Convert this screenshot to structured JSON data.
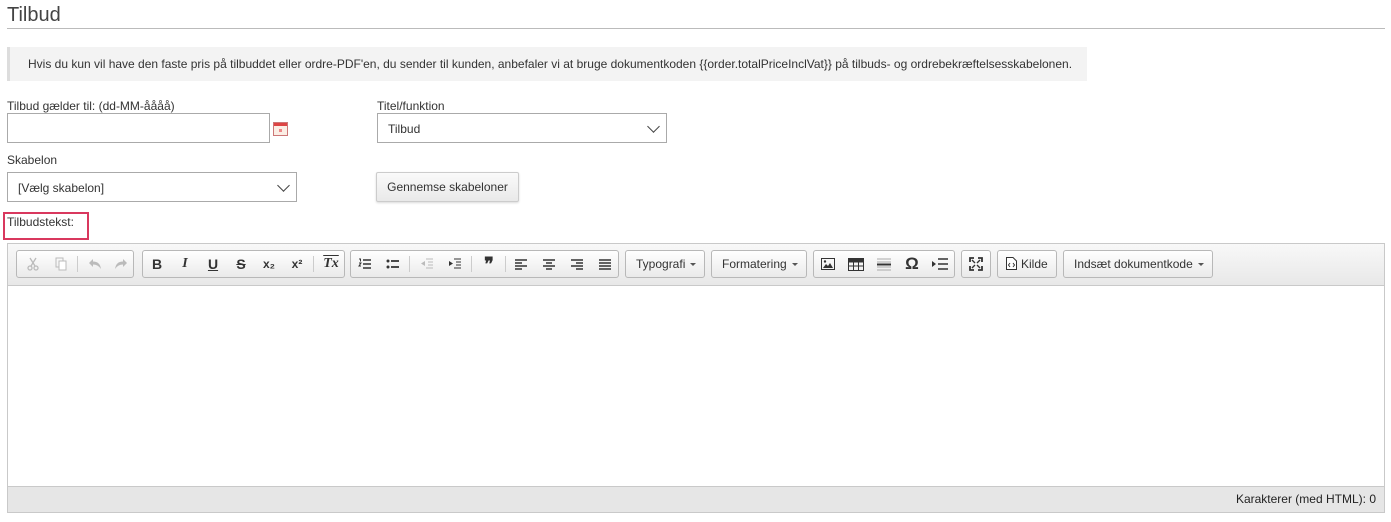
{
  "page": {
    "title": "Tilbud"
  },
  "info_text": "Hvis du kun vil have den faste pris på tilbuddet eller ordre-PDF'en, du sender til kunden, anbefaler vi at bruge dokumentkoden {{order.totalPriceInclVat}} på tilbuds- og ordrebekræftelsesskabelonen.",
  "form": {
    "valid_until_label": "Tilbud gælder til: (dd-MM-åååå)",
    "valid_until_value": "",
    "title_function_label": "Titel/funktion",
    "title_function_value": "Tilbud",
    "template_label": "Skabelon",
    "template_value": "[Vælg skabelon]",
    "browse_templates_button": "Gennemse skabeloner",
    "offer_text_label": "Tilbudstekst:"
  },
  "editor": {
    "toolbar": {
      "bold": "B",
      "italic": "I",
      "underline": "U",
      "strike": "S",
      "subscript": "x₂",
      "superscript": "x²",
      "remove_format": "Tx",
      "blockquote": "❞",
      "special_char": "Ω",
      "typography": "Typografi",
      "formatting": "Formatering",
      "source": "Kilde",
      "insert_doc_code": "Indsæt dokumentkode"
    },
    "content": "",
    "footer": "Karakterer (med HTML): 0"
  },
  "colors": {
    "highlight_border": "#d9385e"
  },
  "icons": [
    "cut-icon",
    "copy-icon",
    "undo-icon",
    "redo-icon",
    "numbered-list-icon",
    "bulleted-list-icon",
    "outdent-icon",
    "indent-icon",
    "align-left-icon",
    "align-center-icon",
    "align-right-icon",
    "justify-icon",
    "image-icon",
    "table-icon",
    "horizontal-rule-icon",
    "page-break-icon",
    "maximize-icon",
    "source-icon",
    "calendar-icon"
  ]
}
